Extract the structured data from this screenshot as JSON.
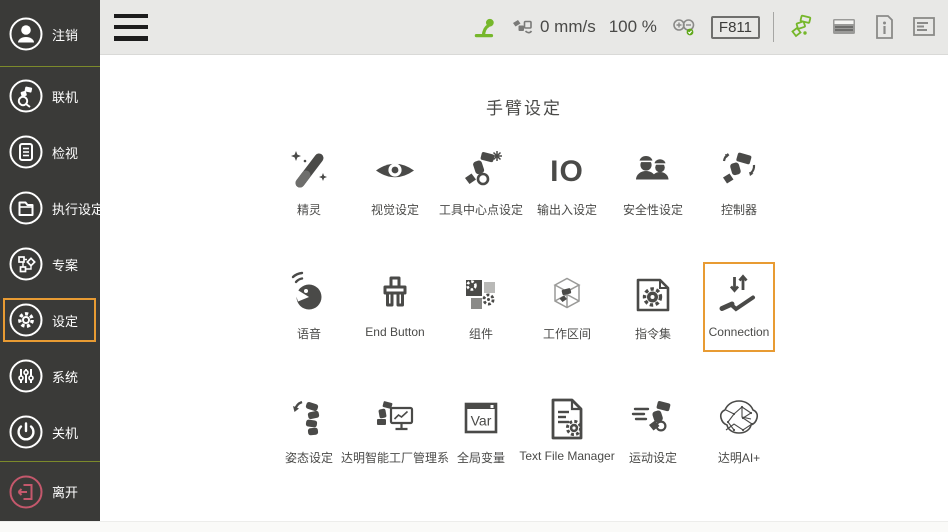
{
  "colors": {
    "sidebar_bg": "#3A3A38",
    "accent_orange": "#E89B33",
    "accent_green": "#76B72B",
    "divider_green": "#7C8A2B",
    "exit_red": "#C4586C",
    "topbar_bg": "#E8E8E6",
    "text_gray": "#4A4A48"
  },
  "sidebar": {
    "items": [
      {
        "name": "logout",
        "label": "注销",
        "icon": "person-icon",
        "divider_after": true
      },
      {
        "name": "online",
        "label": "联机",
        "icon": "link-robot-icon"
      },
      {
        "name": "inspect",
        "label": "检视",
        "icon": "document-view-icon"
      },
      {
        "name": "execution",
        "label": "执行设定",
        "icon": "folder-run-icon"
      },
      {
        "name": "project",
        "label": "专案",
        "icon": "flowchart-icon"
      },
      {
        "name": "settings",
        "label": "设定",
        "icon": "gear-icon",
        "active": true
      },
      {
        "name": "system",
        "label": "系统",
        "icon": "sliders-icon"
      },
      {
        "name": "shutdown",
        "label": "关机",
        "icon": "power-icon",
        "divider_after": true
      },
      {
        "name": "exit",
        "label": "离开",
        "icon": "exit-door-icon",
        "danger": true
      }
    ]
  },
  "topbar": {
    "menu_icon": "hamburger-icon",
    "speed_value": "0 mm/s",
    "speed_percent": "100 %",
    "frame_code": "F811",
    "icons": [
      "pin-icon",
      "gripper-speed-icon",
      "zoom-check-icon",
      "robot-arm-green-icon",
      "keyboard-icon",
      "info-document-icon",
      "log-icon"
    ]
  },
  "main": {
    "title": "手臂设定",
    "items": [
      {
        "name": "genie",
        "label": "精灵",
        "icon": "wand-icon"
      },
      {
        "name": "vision",
        "label": "视觉设定",
        "icon": "eye-icon"
      },
      {
        "name": "tcp",
        "label": "工具中心点设定",
        "icon": "tcp-icon"
      },
      {
        "name": "io",
        "label": "输出入设定",
        "icon": "io-icon"
      },
      {
        "name": "safety",
        "label": "安全性设定",
        "icon": "safety-icon"
      },
      {
        "name": "controller",
        "label": "控制器",
        "icon": "controller-icon"
      },
      {
        "name": "voice",
        "label": "语音",
        "icon": "voice-icon"
      },
      {
        "name": "end-button",
        "label": "End Button",
        "icon": "end-button-icon"
      },
      {
        "name": "component",
        "label": "组件",
        "icon": "component-icon"
      },
      {
        "name": "workspace",
        "label": "工作区间",
        "icon": "workspace-icon"
      },
      {
        "name": "instruction-set",
        "label": "指令集",
        "icon": "instruction-icon"
      },
      {
        "name": "connection",
        "label": "Connection",
        "icon": "connection-icon",
        "active": true
      },
      {
        "name": "posture",
        "label": "姿态设定",
        "icon": "posture-icon"
      },
      {
        "name": "factory-manager",
        "label": "达明智能工厂管理系",
        "icon": "factory-icon"
      },
      {
        "name": "global-variables",
        "label": "全局变量",
        "icon": "var-icon"
      },
      {
        "name": "text-file-manager",
        "label": "Text File Manager",
        "icon": "textfile-icon"
      },
      {
        "name": "motion",
        "label": "运动设定",
        "icon": "motion-icon"
      },
      {
        "name": "tm-ai",
        "label": "达明AI+",
        "icon": "ai-icon"
      }
    ]
  },
  "icon_text": {
    "io": "IO",
    "var": "Var"
  }
}
